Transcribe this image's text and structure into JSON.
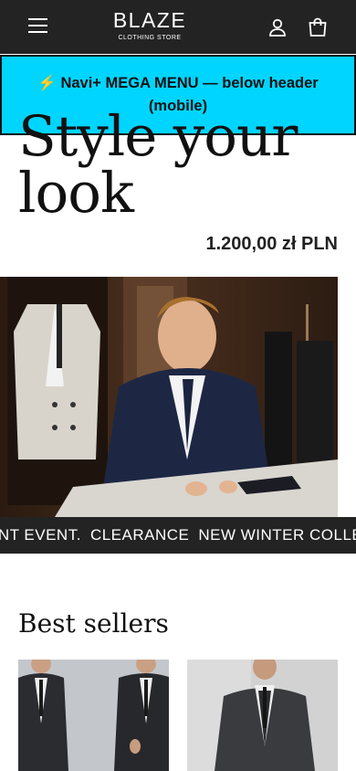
{
  "header": {
    "brand": "BLAZE",
    "tagline": "CLOTHING STORE",
    "menu_icon": "hamburger-icon",
    "account_icon": "user-icon",
    "cart_icon": "shopping-bag-icon",
    "background": "#232323"
  },
  "mega_menu": {
    "label": "⚡ Navi+ MEGA MENU — below header (mobile)",
    "background": "#00d5ff"
  },
  "hero": {
    "title": "Style your look",
    "price": "1.200,00 zł PLN"
  },
  "marquee": {
    "items": [
      "ANT EVENT.",
      "CLEARANCE",
      "NEW WINTER COLLEC"
    ]
  },
  "best_sellers": {
    "title": "Best sellers"
  }
}
